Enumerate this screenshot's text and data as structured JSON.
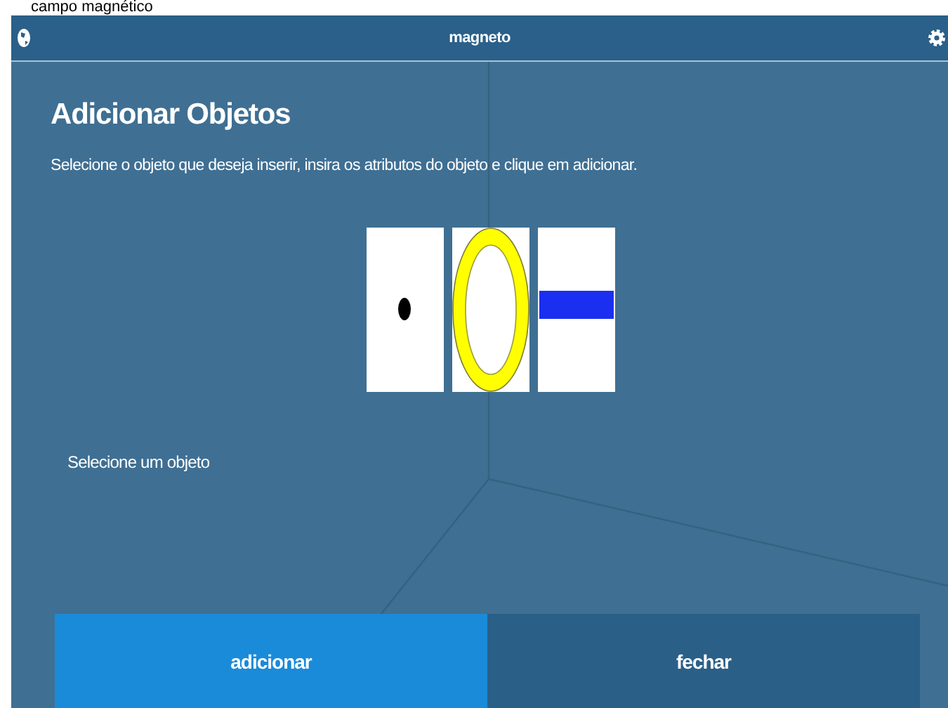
{
  "caption": "campo magnético",
  "app_bar": {
    "title": "magneto"
  },
  "heading": "Adicionar Objetos",
  "instruction": "Selecione o objeto que deseja inserir, insira os atributos do objeto e clique em adicionar.",
  "objects": [
    {
      "kind": "dot"
    },
    {
      "kind": "ring"
    },
    {
      "kind": "bar"
    }
  ],
  "prompt": "Selecione um objeto",
  "buttons": [
    {
      "label": "adicionar",
      "kind": "primary"
    },
    {
      "label": "fechar",
      "kind": "secondary"
    }
  ]
}
